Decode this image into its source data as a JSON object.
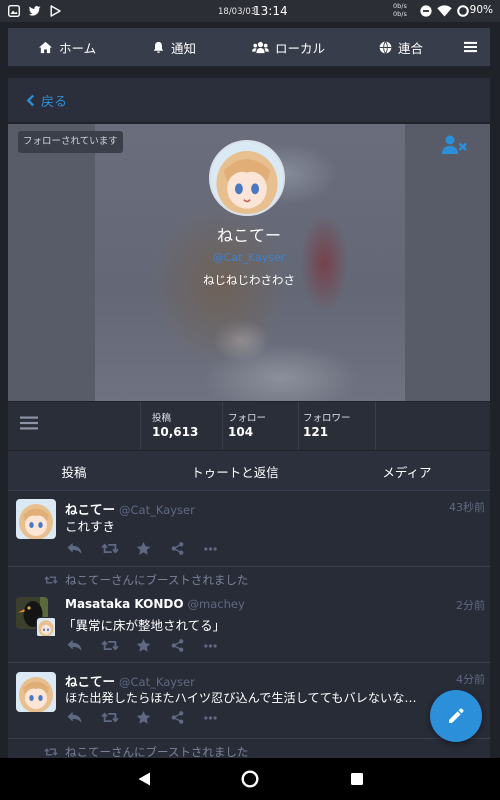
{
  "status_bar": {
    "date": "18/03/03",
    "time": "13:14",
    "net_up": "0b/s",
    "net_down": "0b/s",
    "battery": "90%",
    "left_icons": [
      "image-notification-icon",
      "twitter-icon",
      "play-store-icon"
    ],
    "right_icons": [
      "data-saver-icon",
      "wifi-icon",
      "battery-ring-icon"
    ]
  },
  "nav": {
    "items": [
      {
        "label": "ホーム",
        "icon": "home-icon"
      },
      {
        "label": "通知",
        "icon": "bell-icon"
      },
      {
        "label": "ローカル",
        "icon": "users-icon"
      },
      {
        "label": "連合",
        "icon": "globe-icon"
      }
    ],
    "menu_icon": "bars-icon"
  },
  "back": {
    "label": "戻る",
    "icon": "chevron-left-icon"
  },
  "profile": {
    "followed_badge": "フォローされています",
    "display_name": "ねこてー",
    "handle": "@Cat_Kayser",
    "bio": "ねじねじわさわさ",
    "action_icon": "user-times-icon"
  },
  "stats": {
    "menu_icon": "bars-icon",
    "items": [
      {
        "label": "投稿",
        "value": "10,613"
      },
      {
        "label": "フォロー",
        "value": "104"
      },
      {
        "label": "フォロワー",
        "value": "121"
      }
    ]
  },
  "tabs": [
    {
      "label": "投稿",
      "active": true
    },
    {
      "label": "トゥートと返信",
      "active": false
    },
    {
      "label": "メディア",
      "active": false
    }
  ],
  "statuses": [
    {
      "display_name": "ねこてー",
      "handle": "@Cat_Kayser",
      "time": "43秒前",
      "content": "これすき"
    },
    {
      "boost_text": "ねこてーさんにブーストされました",
      "display_name": "Masataka KONDO",
      "handle": "@machey",
      "time": "2分前",
      "content": "「異常に床が整地されてる」"
    },
    {
      "display_name": "ねこてー",
      "handle": "@Cat_Kayser",
      "time": "4分前",
      "content": "ほた出発したらほたハイツ忍び込んで生活しててもバレないな…"
    },
    {
      "boost_text": "ねこてーさんにブーストされました"
    }
  ],
  "action_icons": [
    "reply-icon",
    "retweet-icon",
    "star-icon",
    "share-icon",
    "ellipsis-icon"
  ],
  "compose_button": {
    "icon": "pencil-icon"
  },
  "system_nav": {
    "icons": [
      "back-icon",
      "home-circle-icon",
      "recents-icon"
    ]
  },
  "colors": {
    "accent": "#2b90d9",
    "background": "#1f2229",
    "column": "#282c37",
    "nav": "#383d4b",
    "muted_text": "#606984"
  }
}
